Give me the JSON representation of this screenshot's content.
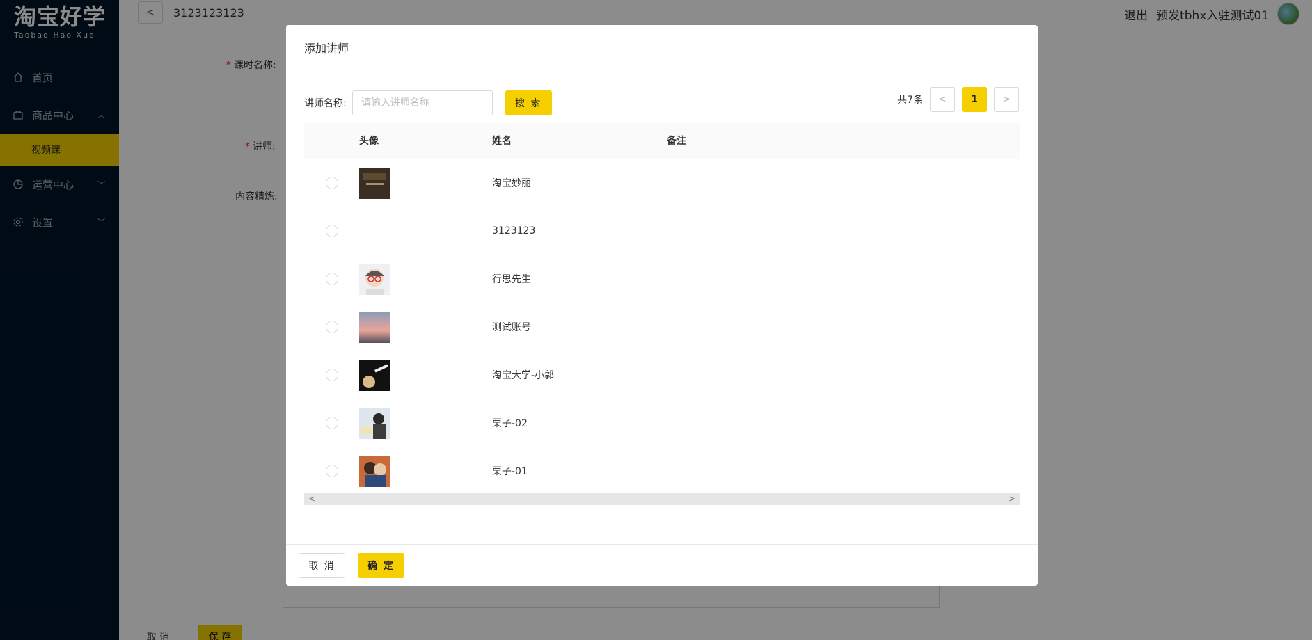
{
  "app": {
    "logo_cn": "淘宝好学",
    "logo_en": "Taobao Hao Xue"
  },
  "sidebar": {
    "items": [
      {
        "label": "首页",
        "icon": "home-icon"
      },
      {
        "label": "商品中心",
        "icon": "shopping-bag-icon",
        "expanded": true
      },
      {
        "label": "视频课",
        "active": true
      },
      {
        "label": "运营中心",
        "icon": "pie-chart-icon"
      },
      {
        "label": "设置",
        "icon": "gear-icon"
      }
    ]
  },
  "topbar": {
    "course_title": "3123123123",
    "logout": "退出",
    "username": "预发tbhx入驻测试01"
  },
  "form": {
    "label_lesson_name": "课时名称:",
    "label_teacher": "讲师:",
    "label_content": "内容精炼:",
    "cancel_label": "取 消",
    "save_label": "保 存"
  },
  "modal": {
    "title": "添加讲师",
    "search_label": "讲师名称:",
    "search_placeholder": "请输入讲师名称",
    "search_value": "",
    "search_button": "搜 索",
    "total_text": "共7条",
    "current_page": "1",
    "columns": [
      "头像",
      "姓名",
      "备注"
    ],
    "rows": [
      {
        "name": "淘宝妙丽",
        "note": "",
        "selected": false
      },
      {
        "name": "3123123",
        "note": "",
        "selected": false
      },
      {
        "name": "行思先生",
        "note": "",
        "selected": false
      },
      {
        "name": "测试账号",
        "note": "",
        "selected": false
      },
      {
        "name": "淘宝大学-小郭",
        "note": "",
        "selected": false
      },
      {
        "name": "栗子-02",
        "note": "",
        "selected": false
      },
      {
        "name": "栗子-01",
        "note": "",
        "selected": false
      }
    ],
    "cancel_button": "取 消",
    "ok_button": "确 定"
  },
  "colors": {
    "accent": "#f5cf00",
    "sidebar_bg": "#001529"
  }
}
